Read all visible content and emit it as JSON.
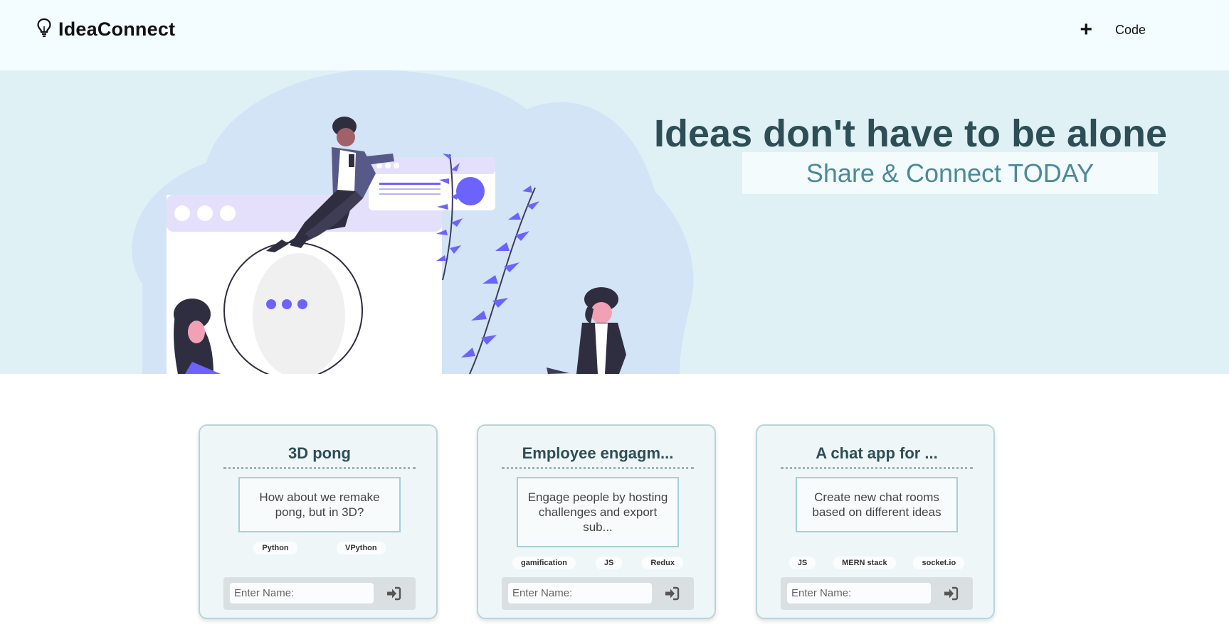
{
  "app": {
    "name": "IdeaConnect"
  },
  "nav": {
    "add_icon": "plus-icon",
    "code_label": "Code"
  },
  "hero": {
    "title": "Ideas don't have to be alone",
    "subtitle": "Share & Connect TODAY"
  },
  "cards": [
    {
      "title": "3D pong",
      "description": "How about we remake pong, but in 3D?",
      "tags": [
        "Python",
        "VPython"
      ],
      "input_placeholder": "Enter Name:"
    },
    {
      "title": "Employee engagm...",
      "description": "Engage people by hosting challenges and export sub...",
      "tags": [
        "gamification",
        "JS",
        "Redux"
      ],
      "input_placeholder": "Enter Name:"
    },
    {
      "title": "A chat app for ...",
      "description": "Create new chat rooms based on different ideas",
      "tags": [
        "JS",
        "MERN stack",
        "socket.io"
      ],
      "input_placeholder": "Enter Name:"
    }
  ],
  "colors": {
    "accent": "#6c63ff",
    "hero_bg": "#dff1f5",
    "title_text": "#2e4e56",
    "subtitle_text": "#4b8a98"
  }
}
